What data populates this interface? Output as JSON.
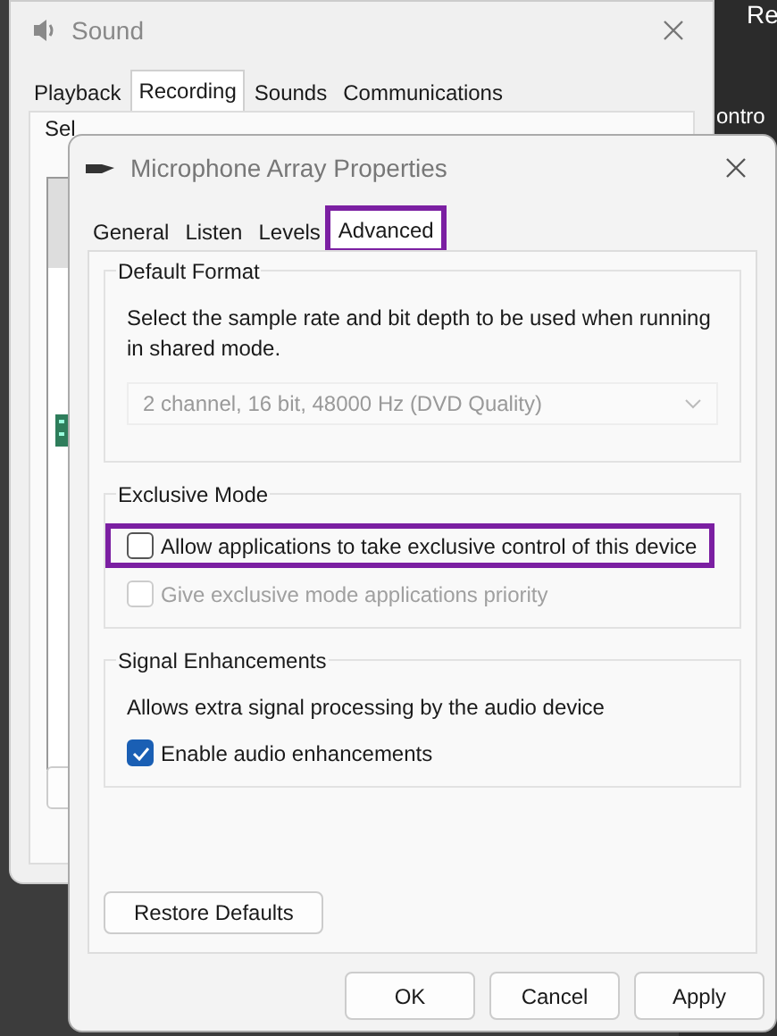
{
  "background_window": {
    "labels": [
      "Re",
      "ontro"
    ]
  },
  "sound_window": {
    "title": "Sound",
    "tabs": [
      {
        "label": "Playback",
        "selected": false
      },
      {
        "label": "Recording",
        "selected": true
      },
      {
        "label": "Sounds",
        "selected": false
      },
      {
        "label": "Communications",
        "selected": false
      }
    ],
    "instruction": "Sel"
  },
  "dialog": {
    "title": "Microphone Array Properties",
    "tabs": [
      {
        "label": "General",
        "selected": false,
        "highlighted": false
      },
      {
        "label": "Listen",
        "selected": false,
        "highlighted": false
      },
      {
        "label": "Levels",
        "selected": false,
        "highlighted": false
      },
      {
        "label": "Advanced",
        "selected": true,
        "highlighted": true
      }
    ],
    "groups": [
      {
        "title": "Default Format",
        "description": "Select the sample rate and bit depth to be used when running in shared mode.",
        "dropdown": {
          "value": "2 channel, 16 bit, 48000 Hz (DVD Quality)",
          "disabled": true
        }
      },
      {
        "title": "Exclusive Mode",
        "options": [
          {
            "label": "Allow applications to take exclusive control of this device",
            "checked": false,
            "disabled": false,
            "highlighted": true
          },
          {
            "label": "Give exclusive mode applications priority",
            "checked": false,
            "disabled": true,
            "highlighted": false
          }
        ]
      },
      {
        "title": "Signal Enhancements",
        "description": "Allows extra signal processing by the audio device",
        "options": [
          {
            "label": "Enable audio enhancements",
            "checked": true,
            "disabled": false,
            "highlighted": false
          }
        ]
      }
    ],
    "restore_button": "Restore Defaults",
    "buttons": [
      "OK",
      "Cancel",
      "Apply"
    ]
  }
}
